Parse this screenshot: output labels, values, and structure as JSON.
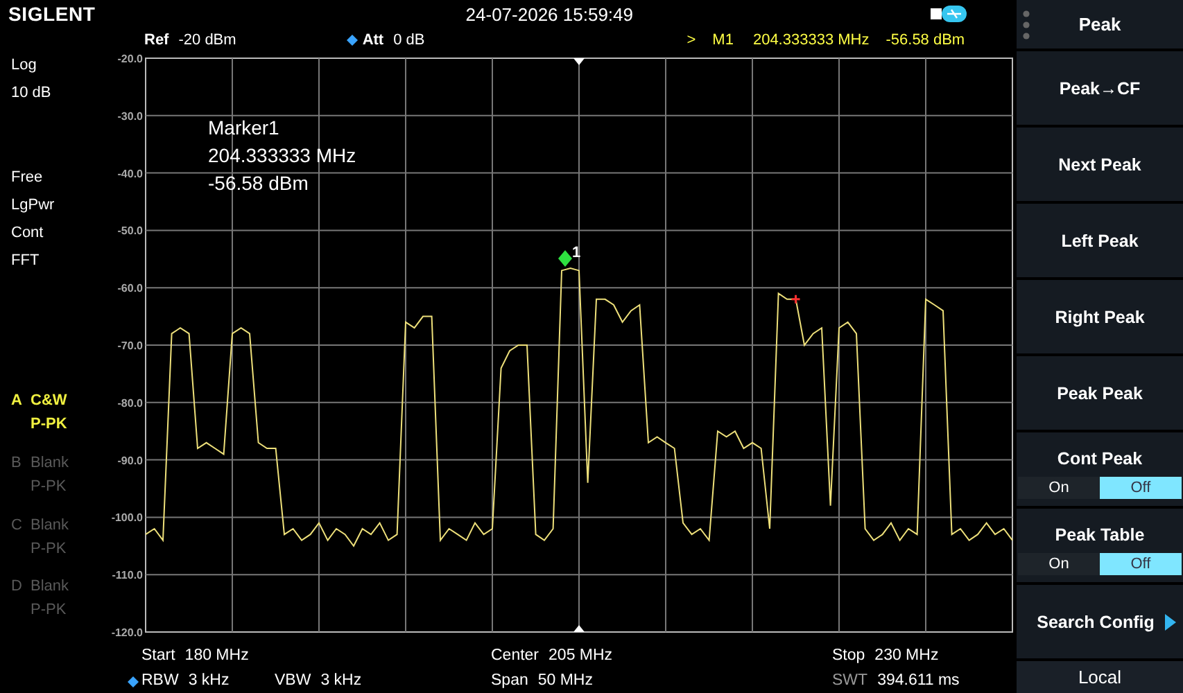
{
  "header": {
    "logo": "SIGLENT",
    "datetime": "24-07-2026 15:59:49"
  },
  "status_row": {
    "ref": {
      "label": "Ref",
      "value": "-20 dBm"
    },
    "att": {
      "label": "Att",
      "value": "0 dB",
      "manual": true
    },
    "marker": {
      "arrow": ">",
      "name": "M1",
      "freq": "204.333333 MHz",
      "level": "-56.58 dBm"
    }
  },
  "left_panel": {
    "scale": [
      "Log",
      "10 dB"
    ],
    "settings": [
      "Free",
      "LgPwr",
      "Cont",
      "FFT"
    ],
    "traces": [
      {
        "letter": "A",
        "type": "C&W",
        "detector": "P-PK",
        "active": true
      },
      {
        "letter": "B",
        "type": "Blank",
        "detector": "P-PK",
        "active": false
      },
      {
        "letter": "C",
        "type": "Blank",
        "detector": "P-PK",
        "active": false
      },
      {
        "letter": "D",
        "type": "Blank",
        "detector": "P-PK",
        "active": false
      }
    ]
  },
  "plot": {
    "marker_readout": [
      "Marker1",
      "204.333333 MHz",
      "-56.58 dBm"
    ],
    "marker_label": "1",
    "chart_data": {
      "type": "line",
      "grid": true,
      "ylim": [
        -120,
        -20
      ],
      "yticks": [
        {
          "value": -20,
          "label": "-20.0"
        },
        {
          "value": -30,
          "label": "-30.0"
        },
        {
          "value": -40,
          "label": "-40.0"
        },
        {
          "value": -50,
          "label": "-50.0"
        },
        {
          "value": -60,
          "label": "-60.0"
        },
        {
          "value": -70,
          "label": "-70.0"
        },
        {
          "value": -80,
          "label": "-80.0"
        },
        {
          "value": -90,
          "label": "-90.0"
        },
        {
          "value": -100,
          "label": "-100.0"
        },
        {
          "value": -110,
          "label": "-110.0"
        },
        {
          "value": -120,
          "label": "-120.0"
        }
      ],
      "categories": [
        null,
        null,
        null,
        null,
        null,
        null,
        null,
        null,
        null,
        null,
        null,
        null,
        null,
        null,
        null,
        null,
        null,
        null,
        null,
        null,
        null,
        null,
        null,
        null,
        null,
        null,
        null,
        null,
        null,
        null,
        null,
        null,
        null,
        null,
        null,
        null,
        null,
        null,
        null,
        null,
        null,
        null,
        null,
        null,
        null,
        null,
        null,
        null,
        null,
        null,
        null,
        null,
        null,
        null,
        null,
        null,
        null,
        null,
        null,
        null,
        null,
        null,
        null,
        null,
        null,
        null,
        null,
        null,
        null,
        null,
        null,
        null,
        null,
        null,
        null,
        null,
        null,
        null,
        null,
        null,
        null,
        null,
        null,
        null,
        null,
        null,
        null,
        null,
        null,
        null,
        null,
        null,
        null,
        null,
        null,
        null,
        null,
        null,
        null,
        null,
        null
      ],
      "series": [
        {
          "color": "#eee07a",
          "values": [
            -103,
            -102,
            -104,
            -68,
            -67,
            -68,
            -88,
            -87,
            -88,
            -89,
            -68,
            -67,
            -68,
            -87,
            -88,
            -88,
            -103,
            -102,
            -104,
            -103,
            -101,
            -104,
            -102,
            -103,
            -105,
            -102,
            -103,
            -101,
            -104,
            -103,
            -66,
            -67,
            -65,
            -65,
            -104,
            -102,
            -103,
            -104,
            -101,
            -103,
            -102,
            -74,
            -71,
            -70,
            -70,
            -103,
            -104,
            -102,
            -57,
            -56.6,
            -57,
            -94,
            -62,
            -62,
            -63,
            -66,
            -64,
            -63,
            -87,
            -86,
            -87,
            -88,
            -101,
            -103,
            -102,
            -104,
            -85,
            -86,
            -85,
            -88,
            -87,
            -88,
            -102,
            -61,
            -62,
            -62,
            -70,
            -68,
            -67,
            -98,
            -67,
            -66,
            -68,
            -102,
            -104,
            -103,
            -101,
            -104,
            -102,
            -103,
            -62,
            -63,
            -64,
            -103,
            -102,
            -104,
            -103,
            -101,
            -103,
            -102,
            -104
          ]
        }
      ]
    }
  },
  "bottom": {
    "start": {
      "label": "Start",
      "value": "180 MHz"
    },
    "center": {
      "label": "Center",
      "value": "205 MHz"
    },
    "stop": {
      "label": "Stop",
      "value": "230 MHz"
    },
    "rbw": {
      "label": "RBW",
      "value": "3 kHz",
      "manual": true
    },
    "vbw": {
      "label": "VBW",
      "value": "3 kHz"
    },
    "span": {
      "label": "Span",
      "value": "50 MHz"
    },
    "swt": {
      "label": "SWT",
      "value": "394.611 ms"
    }
  },
  "softkeys": [
    {
      "kind": "title",
      "label": "Peak"
    },
    {
      "kind": "button",
      "label": "Peak→CF"
    },
    {
      "kind": "button",
      "label": "Next Peak"
    },
    {
      "kind": "button",
      "label": "Left Peak"
    },
    {
      "kind": "button",
      "label": "Right Peak"
    },
    {
      "kind": "button",
      "label": "Peak Peak"
    },
    {
      "kind": "toggle",
      "label": "Cont Peak",
      "options": [
        {
          "label": "On",
          "selected": false
        },
        {
          "label": "Off",
          "selected": true
        }
      ]
    },
    {
      "kind": "toggle",
      "label": "Peak Table",
      "options": [
        {
          "label": "On",
          "selected": false
        },
        {
          "label": "Off",
          "selected": true
        }
      ]
    },
    {
      "kind": "submenu",
      "label": "Search Config"
    }
  ],
  "status": "Local"
}
